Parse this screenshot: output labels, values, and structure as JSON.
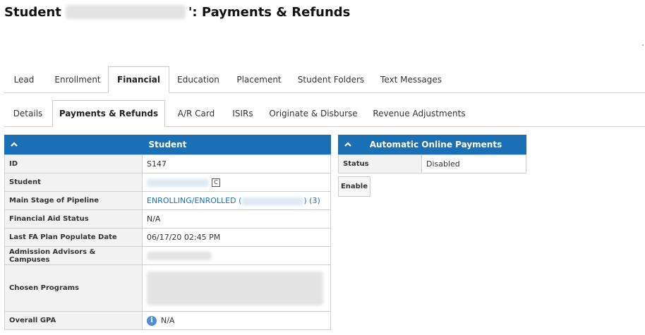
{
  "page": {
    "title_prefix": "Student",
    "title_suffix": "': Payments & Refunds"
  },
  "main_tabs": [
    {
      "label": "Lead",
      "active": false
    },
    {
      "label": "Enrollment",
      "active": false
    },
    {
      "label": "Financial",
      "active": true
    },
    {
      "label": "Education",
      "active": false
    },
    {
      "label": "Placement",
      "active": false
    },
    {
      "label": "Student Folders",
      "active": false
    },
    {
      "label": "Text Messages",
      "active": false
    }
  ],
  "sub_tabs": [
    {
      "label": "Details",
      "active": false
    },
    {
      "label": "Payments & Refunds",
      "active": true
    },
    {
      "label": "A/R Card",
      "active": false
    },
    {
      "label": "ISIRs",
      "active": false
    },
    {
      "label": "Originate & Disburse",
      "active": false
    },
    {
      "label": "Revenue Adjustments",
      "active": false
    }
  ],
  "student_panel": {
    "header": "Student",
    "rows": {
      "id": {
        "label": "ID",
        "value": "S147"
      },
      "student": {
        "label": "Student",
        "icon_text": "C"
      },
      "pipeline": {
        "label": "Main Stage of Pipeline",
        "value_prefix": "ENROLLING/ENROLLED (",
        "value_suffix": ") (3)"
      },
      "fa_status": {
        "label": "Financial Aid Status",
        "value": "N/A"
      },
      "fa_plan": {
        "label": "Last FA Plan Populate Date",
        "value": "06/17/20 02:45 PM"
      },
      "advisors": {
        "label": "Admission Advisors & Campuses"
      },
      "programs": {
        "label": "Chosen Programs"
      },
      "gpa": {
        "label": "Overall GPA",
        "value": "N/A",
        "icon_text": "i"
      }
    }
  },
  "payments_panel": {
    "header": "Automatic Online Payments",
    "status_label": "Status",
    "status_value": "Disabled",
    "enable_label": "Enable"
  },
  "icons": {
    "collapse": "chevron-up-icon",
    "info": "info-icon",
    "copy": "c-badge-icon"
  },
  "colors": {
    "header_blue": "#1a6fb5",
    "link_blue": "#1a6fb5",
    "label_bg": "#f2f2f2",
    "border": "#cfcfcf"
  }
}
